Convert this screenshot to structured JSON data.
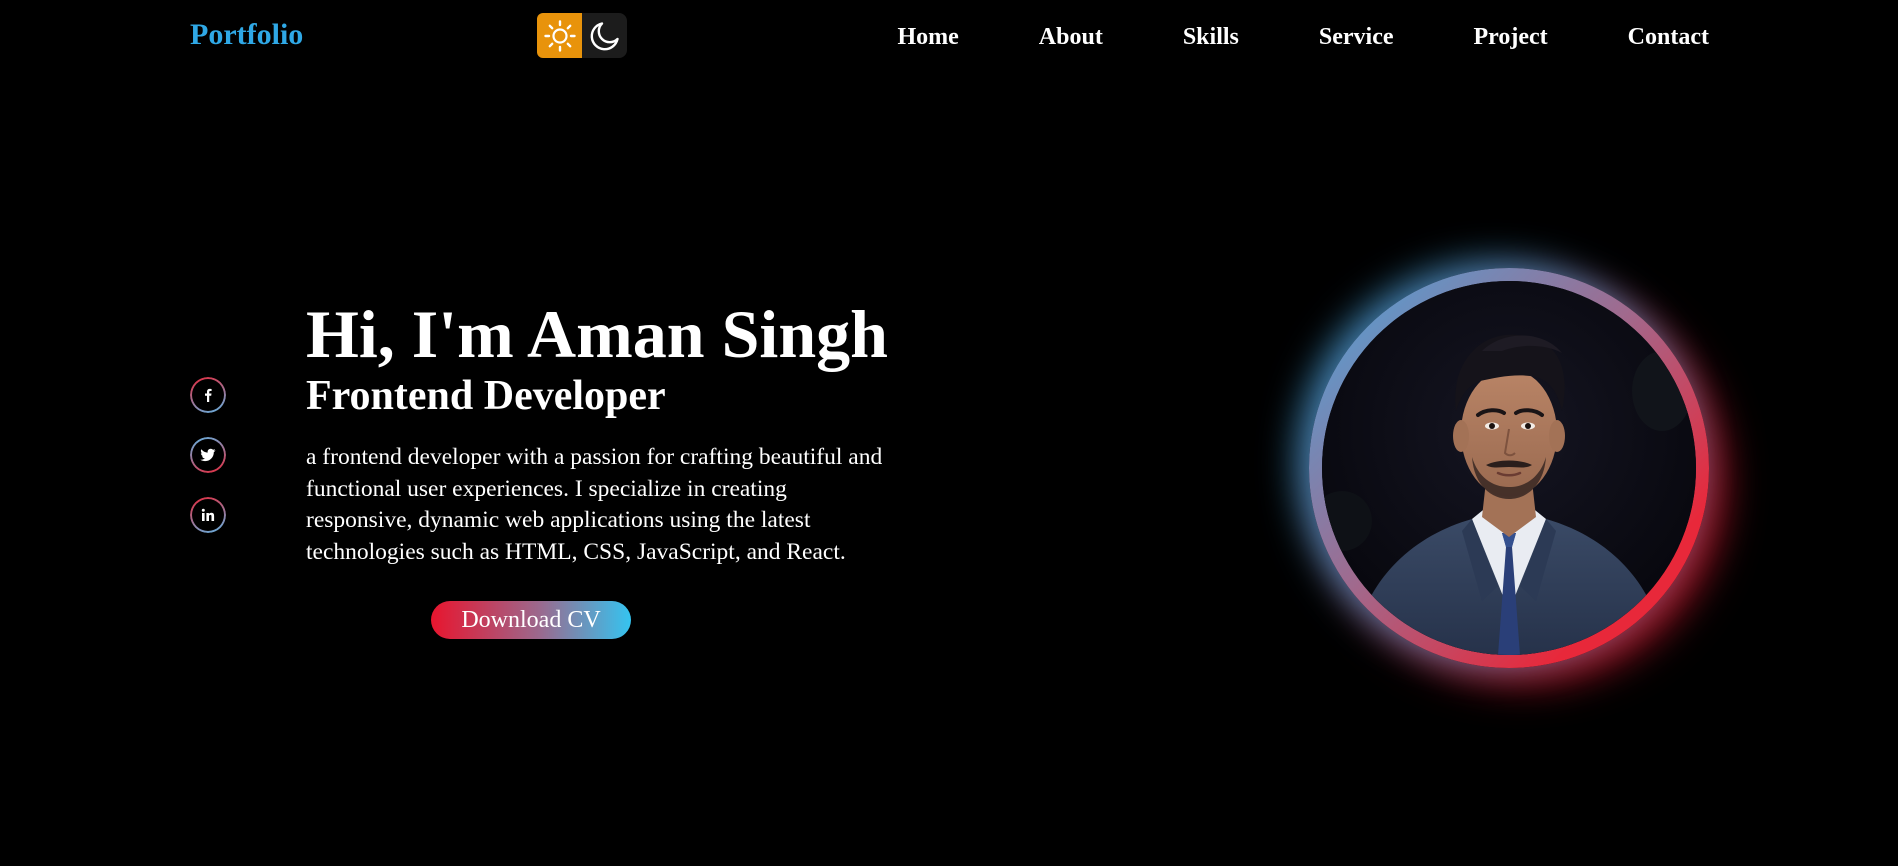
{
  "header": {
    "brand": "Portfolio",
    "theme": {
      "light_icon": "sun-icon",
      "dark_icon": "moon-icon",
      "light_color": "#e8930b"
    },
    "nav": [
      {
        "label": "Home"
      },
      {
        "label": "About"
      },
      {
        "label": "Skills"
      },
      {
        "label": "Service"
      },
      {
        "label": "Project"
      },
      {
        "label": "Contact"
      }
    ]
  },
  "socials": [
    {
      "icon": "facebook-icon"
    },
    {
      "icon": "twitter-icon"
    },
    {
      "icon": "linkedin-icon"
    }
  ],
  "hero": {
    "title": "Hi, I'm Aman Singh",
    "subtitle": "Frontend Developer",
    "description": "a frontend developer with a passion for crafting beautiful and functional user experiences. I specialize in creating responsive, dynamic web applications using the latest technologies such as HTML, CSS, JavaScript, and React.",
    "cta": "Download CV"
  },
  "colors": {
    "background": "#000000",
    "brand": "#2fa8e6",
    "gradient_red": "#e8152e",
    "gradient_blue": "#35c4f0"
  }
}
